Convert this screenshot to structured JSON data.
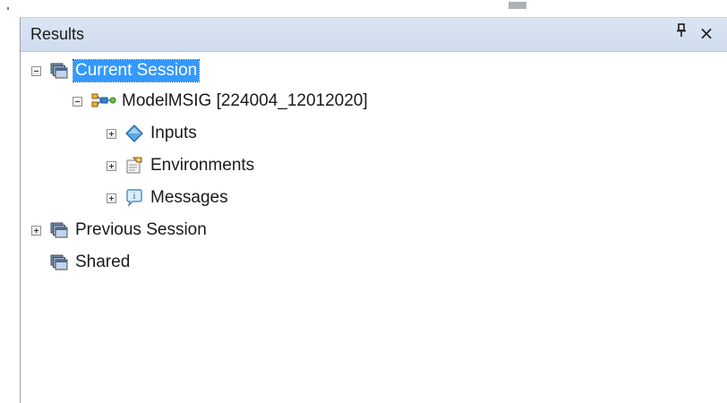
{
  "panel": {
    "title": "Results",
    "pin_glyph": "q",
    "close_glyph": "×"
  },
  "tree": {
    "current_session": {
      "label": "Current Session",
      "icon": "session-icon",
      "expanded": true,
      "selected": true
    },
    "model": {
      "label": "ModelMSIG [224004_12012020]",
      "icon": "model-icon",
      "expanded": true
    },
    "inputs": {
      "label": "Inputs",
      "icon": "inputs-diamond-icon",
      "expanded": false
    },
    "environments": {
      "label": "Environments",
      "icon": "environments-icon",
      "expanded": false
    },
    "messages": {
      "label": "Messages",
      "icon": "messages-icon",
      "expanded": false
    },
    "previous_session": {
      "label": "Previous Session",
      "icon": "session-icon",
      "expanded": false
    },
    "shared": {
      "label": "Shared",
      "icon": "session-icon"
    }
  },
  "colors": {
    "selection": "#3399ff",
    "titlebar": "#d6e2f2"
  }
}
